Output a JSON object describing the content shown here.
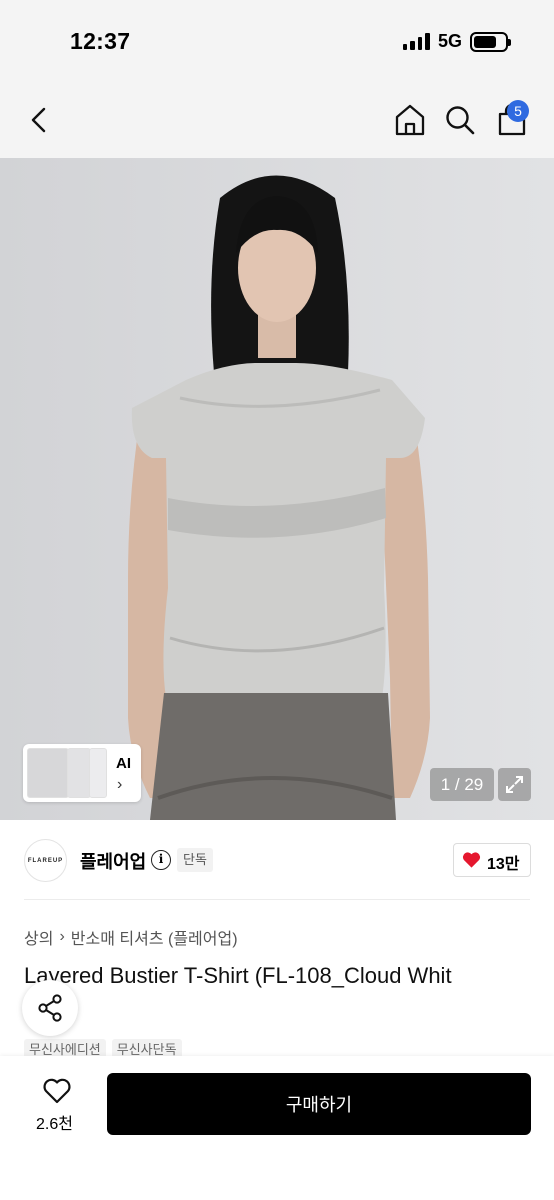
{
  "status_bar": {
    "time": "12:37",
    "network": "5G",
    "battery_level": 0.72
  },
  "nav": {
    "back_icon": "chevron-left-icon",
    "home_icon": "home-icon",
    "search_icon": "search-icon",
    "cart_icon": "cart-icon",
    "cart_badge": "5",
    "badge_color": "#2f6ae0"
  },
  "gallery": {
    "ai_label": "AI",
    "ai_chevron": "›",
    "page_counter": "1 / 29",
    "expand_icon": "expand-icon"
  },
  "brand": {
    "logo_text": "FLAREUP",
    "name": "플레어업",
    "info_icon": "i",
    "badge": "단독",
    "like_count": "13만",
    "heart_color": "#e5172e"
  },
  "breadcrumb": {
    "category": "상의",
    "separator": "›",
    "subcategory": "반소매 티셔츠 (플레어업)"
  },
  "product": {
    "title": "Layered Bustier T-Shirt (FL-108_Cloud Whit",
    "tags": [
      "무신사에디션",
      "무신사단독"
    ]
  },
  "bottom": {
    "like_count": "2.6천",
    "buy_label": "구매하기"
  }
}
